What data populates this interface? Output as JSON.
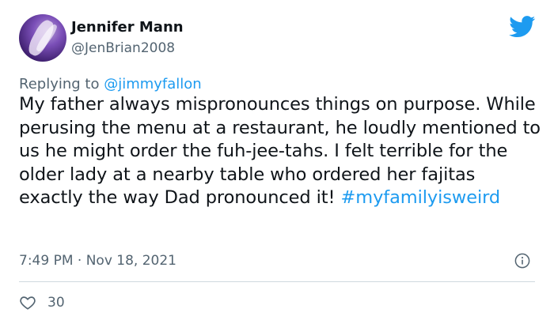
{
  "author": {
    "name": "Jennifer Mann",
    "handle": "@JenBrian2008"
  },
  "reply": {
    "prefix": "Replying to ",
    "mention": "@jimmyfallon"
  },
  "tweet": {
    "text": "My father always mispronounces things on purpose. While perusing the menu at a restaurant, he loudly mentioned to us he might order the fuh-jee-tahs. I felt terrible for the older lady at a nearby table who ordered her fajitas exactly the way Dad pronounced it! ",
    "hashtag": "#myfamilyisweird",
    "timestamp": "7:49 PM · Nov 18, 2021"
  },
  "engagement": {
    "likes": "30"
  },
  "colors": {
    "accent": "#1d9bf0",
    "muted": "#536471",
    "text": "#0f1419",
    "divider": "#cfd9de"
  },
  "icons": {
    "brand": "twitter-bird-icon",
    "info": "info-icon",
    "like": "heart-icon"
  }
}
